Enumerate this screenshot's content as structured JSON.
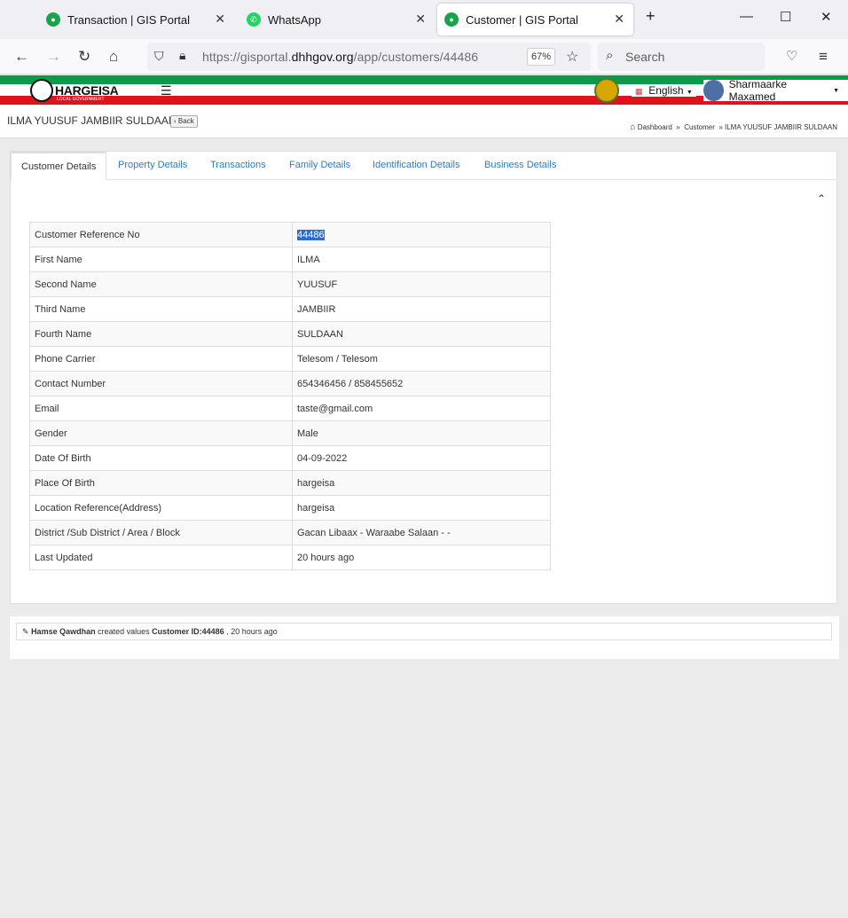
{
  "browser": {
    "tabs": [
      {
        "title": "Transaction | GIS Portal",
        "active": false
      },
      {
        "title": "WhatsApp",
        "active": false
      },
      {
        "title": "Customer | GIS Portal",
        "active": true
      }
    ],
    "url_prefix": "https://gisportal.",
    "url_domain": "dhhgov.org",
    "url_path": "/app/customers/44486",
    "zoom": "67%",
    "search_placeholder": "Search"
  },
  "header": {
    "brand": "HARGEISA",
    "brand_sub": "LOCAL GOVERNMENT",
    "language": "English",
    "user_name": "Sharmaarke Maxamed"
  },
  "page": {
    "title": "ILMA YUUSUF JAMBIIR SULDAAN",
    "back_label": "Back",
    "breadcrumb": {
      "dashboard": "Dashboard",
      "customer": "Customer",
      "current": "ILMA YUUSUF JAMBIIR SULDAAN"
    }
  },
  "tabs": [
    {
      "label": "Customer Details"
    },
    {
      "label": "Property Details"
    },
    {
      "label": "Transactions"
    },
    {
      "label": "Family Details"
    },
    {
      "label": "Identification Details"
    },
    {
      "label": "Business Details"
    }
  ],
  "details": [
    {
      "label": "Customer Reference No",
      "value": "44486"
    },
    {
      "label": "First Name",
      "value": "ILMA"
    },
    {
      "label": "Second Name",
      "value": "YUUSUF"
    },
    {
      "label": "Third Name",
      "value": "JAMBIIR"
    },
    {
      "label": "Fourth Name",
      "value": "SULDAAN"
    },
    {
      "label": "Phone Carrier",
      "value": "Telesom / Telesom"
    },
    {
      "label": "Contact Number",
      "value": "654346456 / 858455652"
    },
    {
      "label": "Email",
      "value": "taste@gmail.com"
    },
    {
      "label": "Gender",
      "value": "Male"
    },
    {
      "label": "Date Of Birth",
      "value": "04-09-2022"
    },
    {
      "label": "Place Of Birth",
      "value": "hargeisa"
    },
    {
      "label": "Location Reference(Address)",
      "value": "hargeisa"
    },
    {
      "label": "District /Sub District / Area / Block",
      "value": "Gacan Libaax - Waraabe Salaan - -"
    },
    {
      "label": "Last Updated",
      "value": "20 hours ago"
    }
  ],
  "activity": {
    "user": "Hamse Qawdhan",
    "action": " created values ",
    "target": "Customer ID:44486",
    "time": " , 20 hours ago"
  }
}
